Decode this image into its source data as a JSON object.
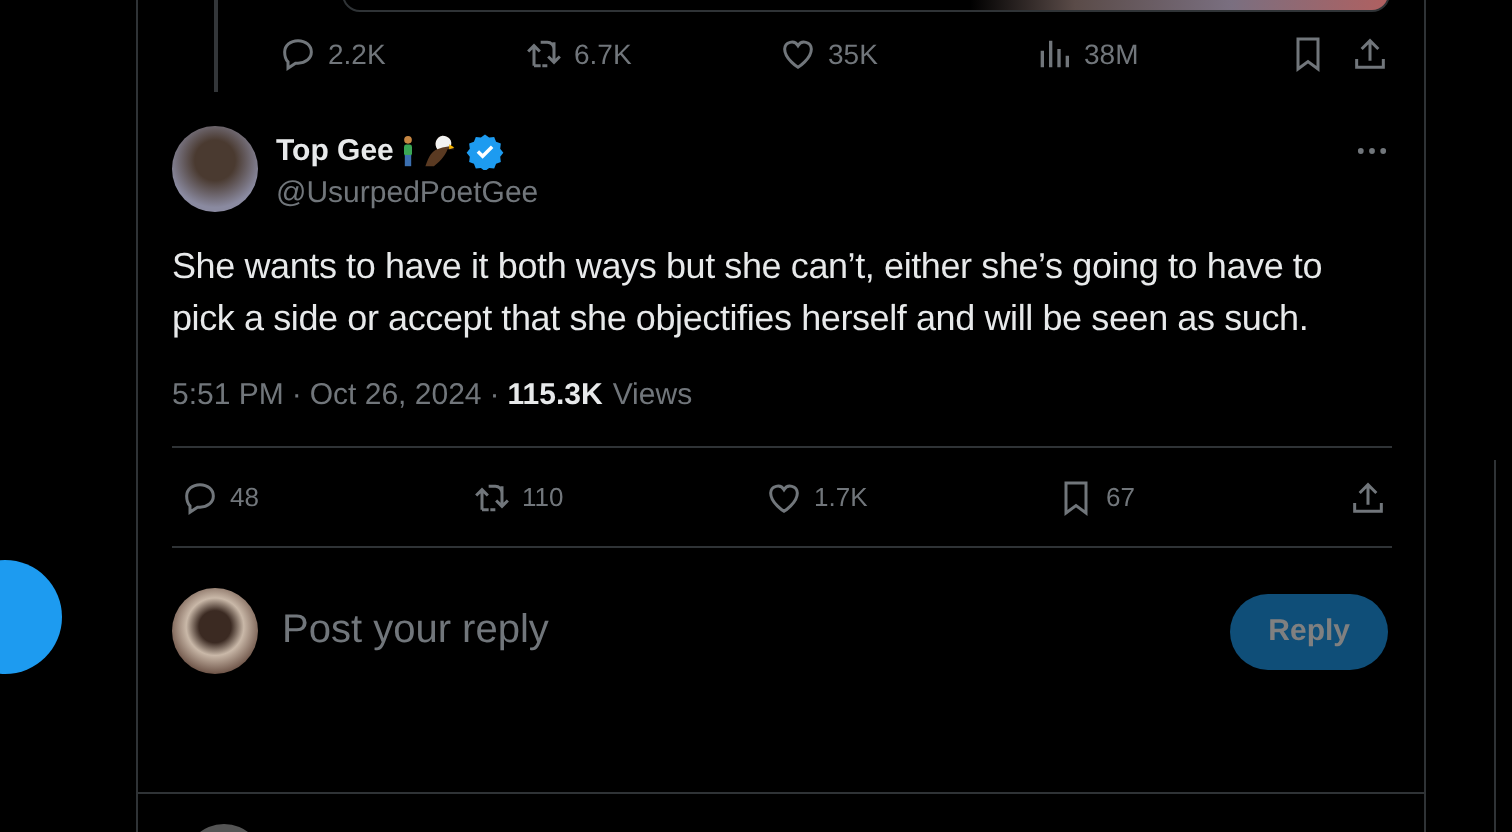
{
  "previous_tweet": {
    "actions": [
      {
        "kind": "reply",
        "count": "2.2K"
      },
      {
        "kind": "repost",
        "count": "6.7K"
      },
      {
        "kind": "like",
        "count": "35K"
      },
      {
        "kind": "views",
        "count": "38M"
      },
      {
        "kind": "bookmark"
      },
      {
        "kind": "share"
      }
    ]
  },
  "tweet": {
    "name": "Top Gee",
    "verified": true,
    "handle": "@UsurpedPoetGee",
    "text": "She wants to have it both ways but she can’t, either she’s going to have to pick a side or accept that she objectifies herself and will be seen as such.",
    "time": "5:51 PM",
    "date": "Oct 26, 2024",
    "views_count": "115.3K",
    "views_label": "Views",
    "separator": "·",
    "actions": [
      {
        "kind": "reply",
        "count": "48"
      },
      {
        "kind": "repost",
        "count": "110"
      },
      {
        "kind": "like",
        "count": "1.7K"
      },
      {
        "kind": "bookmark",
        "count": "67"
      },
      {
        "kind": "share"
      }
    ]
  },
  "composer": {
    "placeholder": "Post your reply",
    "button": "Reply",
    "disabled": true
  }
}
